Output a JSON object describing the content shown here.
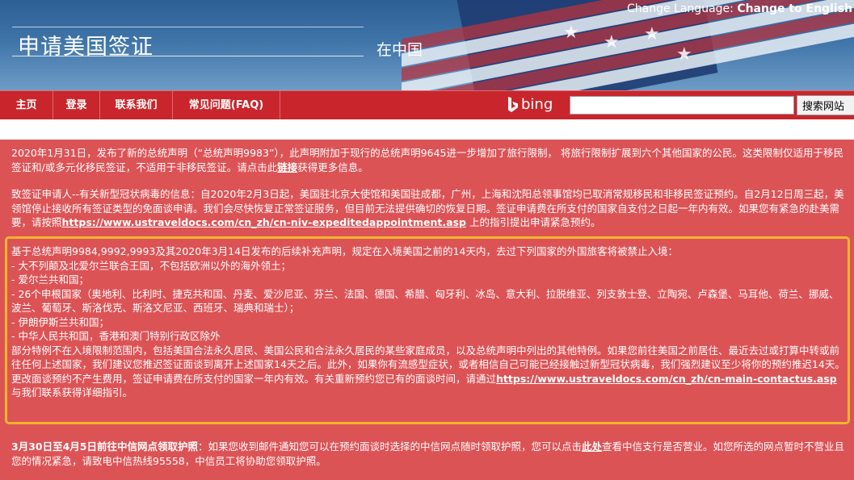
{
  "header": {
    "language_prefix": "Change Language: ",
    "language_link": "Change to English",
    "site_title": "申请美国签证",
    "country": "在中国"
  },
  "nav": {
    "items": [
      "主页",
      "登录",
      "联系我们",
      "常见问题(FAQ)"
    ],
    "search_brand": "bing",
    "search_placeholder": "",
    "search_button": "搜索网站"
  },
  "content": {
    "p1": {
      "text": "2020年1月31日，发布了新的总统声明（“总统声明9983”），此声明附加于现行的总统声明9645进一步增加了旅行限制， 将旅行限制扩展到六个其他国家的公民。这类限制仅适用于移民签证和/或多元化移民签证，不适用于非移民签证。请点击此",
      "link": "链接",
      "after": "获得更多信息。"
    },
    "p2": {
      "text": "致签证申请人--有关新型冠状病毒的信息：自2020年2月3日起，美国驻北京大使馆和美国驻成都，广州，上海和沈阳总领事馆均已取消常规移民和非移民签证预约。自2月12日周三起，美领馆停止接收所有签证类型的免面谈申请。我们会尽快恢复正常签证服务，但目前无法提供确切的恢复日期。签证申请费在所支付的国家自支付之日起一年内有效。如果您有紧急的赴美需要，请按照",
      "link": "https://www.ustraveldocs.com/cn_zh/cn-niv-expeditedappointment.asp",
      "after": " 上的指引提出申请紧急预约。"
    },
    "p3": {
      "lines": [
        "基于总统声明9984,9992,9993及其2020年3月14日发布的后续补充声明，规定在入境美国之前的14天内，去过下列国家的外国旅客将被禁止入境：",
        "- 大不列颠及北爱尔兰联合王国，不包括欧洲以外的海外领土；",
        "- 爱尔兰共和国；",
        "- 26个申根国家（奥地利、比利时、捷克共和国、丹麦、爱沙尼亚、芬兰、法国、德国、希腊、匈牙利、冰岛、意大利、拉脱维亚、列支敦士登、立陶宛、卢森堡、马耳他、荷兰、挪威、波兰、葡萄牙、斯洛伐克、斯洛文尼亚、西班牙、瑞典和瑞士）；",
        "- 伊朗伊斯兰共和国；",
        "- 中华人民共和国，香港和澳门特别行政区除外"
      ],
      "tail": "部分特例不在入境限制范围内，包括美国合法永久居民、美国公民和合法永久居民的某些家庭成员，以及总统声明中列出的其他特例。如果您前往美国之前居住、最近去过或打算中转或前往任何上述国家，我们建议您推迟签证面谈到离开上述国家14天之后。此外，如果你有流感型症状，或者相信自己可能已经接触过新型冠状病毒，我们强烈建议至少将你的预约推迟14天。更改面谈预约不产生费用，签证申请费在所支付的国家一年内有效。有关重新预约您已有的面谈时间，请通过",
      "link": "https://www.ustraveldocs.com/cn_zh/cn-main-contactus.asp",
      "after": "与我们联系获得详细指引。"
    },
    "p4": {
      "bold": "3月30日至4月5日前往中信网点领取护照",
      "text": "：如果您收到邮件通知您可以在预约面谈时选择的中信网点随时领取护照，您可以点击",
      "link": "此处",
      "after": "查看中信支行是否营业。如您所选的网点暂时不营业且您的情况紧急，请致电中信热线95558，中信员工将协助您领取护照。"
    }
  },
  "colors": {
    "nav_red": "#c8262c",
    "content_red": "#dc5356",
    "highlight_border": "#f1b52d"
  }
}
